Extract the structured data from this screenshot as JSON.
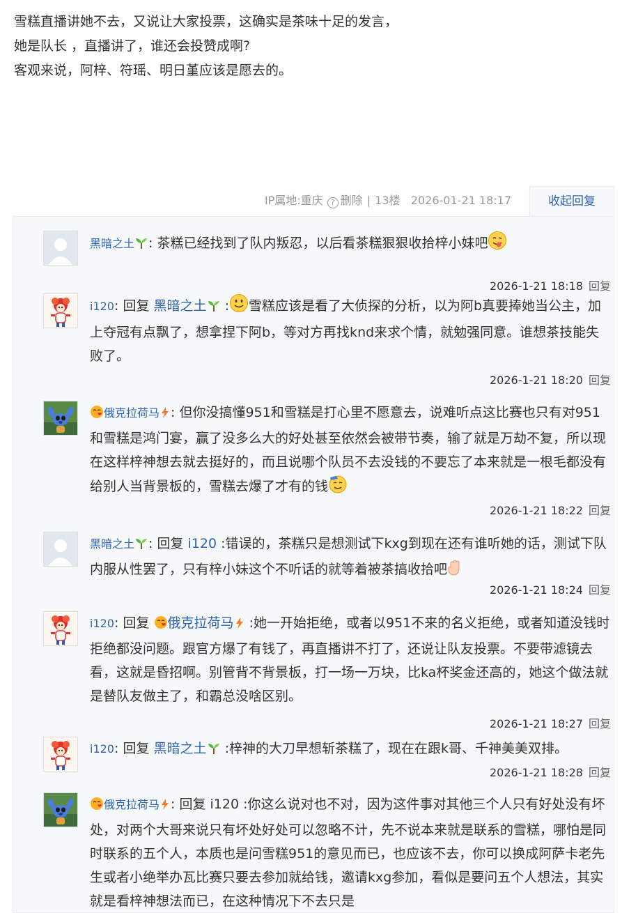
{
  "post": {
    "lines": [
      "雪糕直播讲她不去，又说让大家投票，这确实是茶味十足的发言，",
      "她是队长 ，直播讲了，谁还会投赞成啊?",
      "客观来说，阿梓、符瑶、明日堇应该是愿去的。"
    ],
    "ip_label": "IP属地:重庆",
    "delete_label": "删除",
    "separator": "|",
    "floor": "13楼",
    "datetime": "2026-01-21 18:17",
    "collapse_label": "收起回复"
  },
  "replies": [
    {
      "user": "黑暗之土",
      "parts": [
        ": 茶糕已经找到了队内叛忍，以后看茶糕狠狠收拾梓小妹吧"
      ],
      "time": "2026-1-21 18:18",
      "reply_label": "回复"
    },
    {
      "user": "i120",
      "reply_word": "回复",
      "target": "黑暗之土",
      "parts": [
        ":",
        "雪糕应该是看了大侦探的分析，以为阿b真要捧她当公主，加上夺冠有点飘了，想拿捏下阿b，等对方再找knd来求个情，就勉强同意。谁想茶技能失败了。"
      ],
      "time": "2026-1-21 18:20",
      "reply_label": "回复"
    },
    {
      "user": "俄克拉荷马",
      "parts": [
        ": 但你没搞懂951和雪糕是打心里不愿意去，说难听点这比赛也只有对951和雪糕是鸿门宴，赢了没多么大的好处甚至依然会被带节奏，输了就是万劫不复，所以现在这样梓神想去就去挺好的，而且说哪个队员不去没钱的不要忘了本来就是一根毛都没有给别人当背景板的，雪糕去爆了才有的钱"
      ],
      "time": "2026-1-21 18:22",
      "reply_label": "回复"
    },
    {
      "user": "黑暗之土",
      "reply_word": "回复",
      "target": "i120",
      "parts": [
        ":错误的，茶糕只是想测试下kxg到现在还有谁听她的话，测试下队内服从性罢了，只有梓小妹这个不听话的就等着被茶搞收拾吧"
      ],
      "time": "2026-1-21 18:24",
      "reply_label": "回复"
    },
    {
      "user": "i120",
      "reply_word": "回复",
      "target": "俄克拉荷马",
      "parts": [
        ":她一开始拒绝，或者以951不来的名义拒绝，或者知道没钱时拒绝都没问题。跟官方爆了有钱了，再直播讲不打了，还说让队友投票。不要带滤镜去看，这就是昏招啊。别管背不背景板，打一场一万块，比ka杯奖金还高的，她这个做法就是替队友做主了，和霸总没啥区别。"
      ],
      "time": "2026-1-21 18:27",
      "reply_label": "回复"
    },
    {
      "user": "i120",
      "reply_word": "回复",
      "target": "黑暗之土",
      "parts": [
        ":梓神的大刀早想斩茶糕了，现在在跟k哥、千神美美双排。"
      ],
      "time": "2026-1-21 18:28",
      "reply_label": "回复"
    },
    {
      "user": "俄克拉荷马",
      "reply_word": "回复",
      "target": "i120",
      "parts": [
        ":你这么说对也不对，因为这件事对其他三个人只有好处没有坏处，对两个大哥来说只有坏处好处可以忽略不计，先不说本来就是联系的雪糕，哪怕是同时联系的五个人，本质也是问雪糕951的意见而已，也应该不去，你可以换成阿萨卡老先生或者小绝举办瓦比赛只要去参加就给钱，邀请kxg参加，看似是要问五个人想法，其实就是看梓神想法而已，在这种情况下不去只是"
      ],
      "time": "",
      "reply_label": ""
    }
  ]
}
